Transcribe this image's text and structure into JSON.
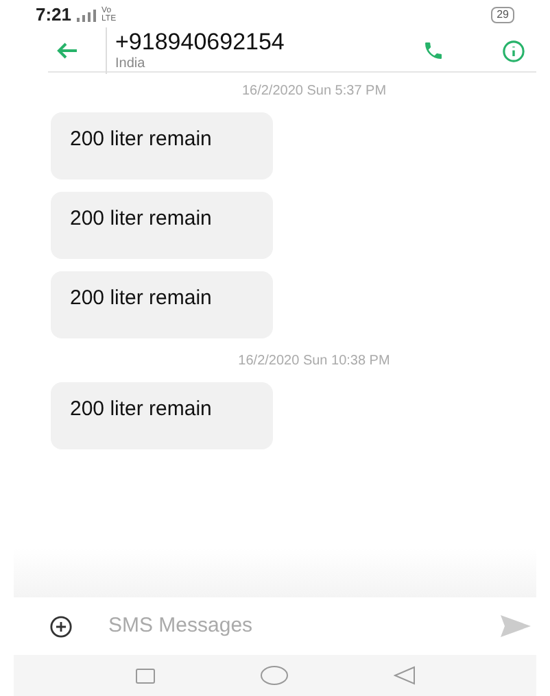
{
  "status_bar": {
    "time": "7:21",
    "network": [
      "Vo",
      "LTE"
    ],
    "battery": "29"
  },
  "header": {
    "title": "+918940692154",
    "subtitle": "India"
  },
  "thread": [
    {
      "kind": "date",
      "text": "16/2/2020 Sun 5:37 PM"
    },
    {
      "kind": "message",
      "text": "200 liter remain"
    },
    {
      "kind": "message",
      "text": "200 liter remain"
    },
    {
      "kind": "message",
      "text": "200 liter remain"
    },
    {
      "kind": "date",
      "text": "16/2/2020 Sun 10:38 PM"
    },
    {
      "kind": "message",
      "text": "200 liter remain"
    }
  ],
  "composer": {
    "placeholder": "SMS Messages"
  }
}
